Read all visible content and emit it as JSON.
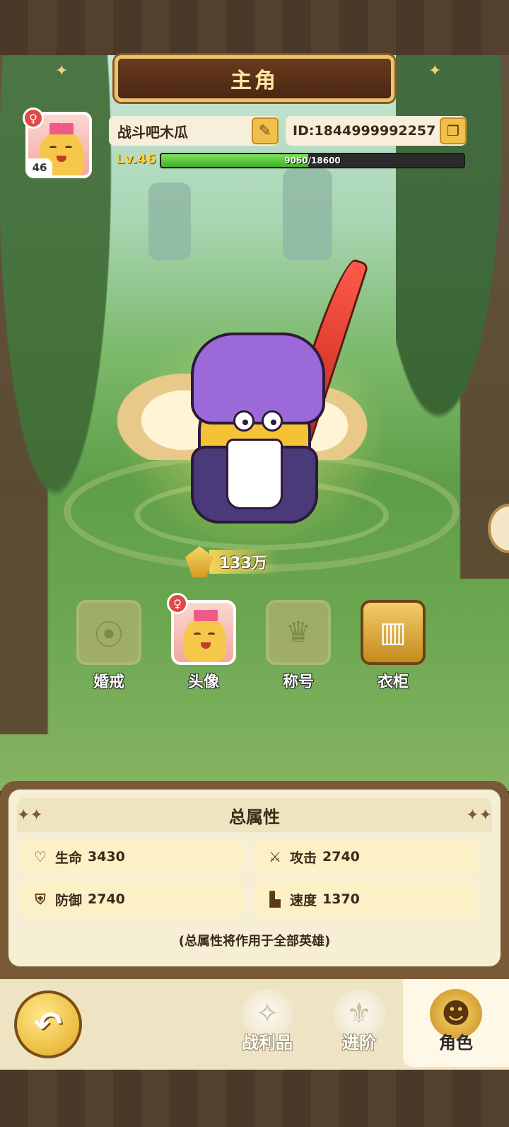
{
  "header": {
    "title": "主角"
  },
  "player": {
    "level_badge": "46",
    "gender_symbol": "♀",
    "name": "战斗吧木瓜",
    "id": "ID:1844999992257",
    "level_label": "Lv.46",
    "xp_current": 9060,
    "xp_max": 18600,
    "xp_text": "9060/18600"
  },
  "combat_power": "133万",
  "functions": [
    {
      "label": "婚戒"
    },
    {
      "label": "头像"
    },
    {
      "label": "称号"
    },
    {
      "label": "衣柜"
    }
  ],
  "attributes": {
    "title": "总属性",
    "stats": [
      {
        "name": "生命",
        "value": "3430",
        "icon": "heart-icon"
      },
      {
        "name": "攻击",
        "value": "2740",
        "icon": "attack-icon"
      },
      {
        "name": "防御",
        "value": "2740",
        "icon": "shield-icon"
      },
      {
        "name": "速度",
        "value": "1370",
        "icon": "boot-icon"
      }
    ],
    "note": "(总属性将作用于全部英雄)"
  },
  "nav": {
    "items": [
      {
        "label": "战利品"
      },
      {
        "label": "进阶"
      },
      {
        "label": "角色"
      }
    ],
    "active": "角色"
  }
}
